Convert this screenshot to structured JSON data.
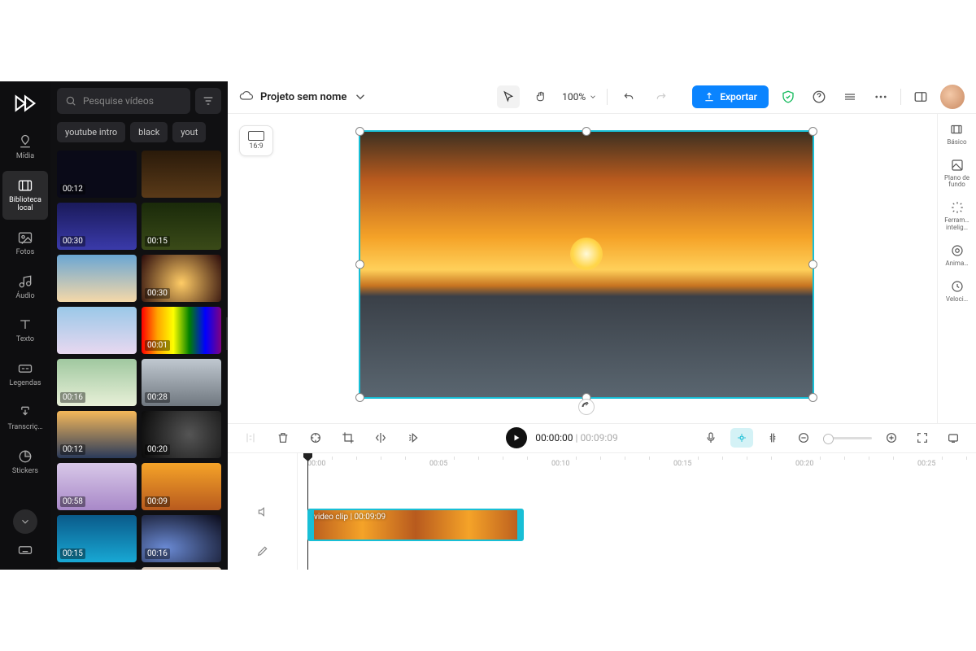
{
  "rail": {
    "items": [
      {
        "label": "Mídia"
      },
      {
        "label": "Biblioteca local"
      },
      {
        "label": "Fotos"
      },
      {
        "label": "Áudio"
      },
      {
        "label": "Texto"
      },
      {
        "label": "Legendas"
      },
      {
        "label": "Transcriç…"
      },
      {
        "label": "Stickers"
      }
    ]
  },
  "library": {
    "search_placeholder": "Pesquise vídeos",
    "chips": [
      "youtube intro",
      "black",
      "yout"
    ],
    "thumbs": [
      {
        "dur": "00:12",
        "bg": "#0a0a18"
      },
      {
        "dur": "",
        "bg": "linear-gradient(#2a1a0a,#5a3a18)"
      },
      {
        "dur": "00:30",
        "bg": "linear-gradient(#1a1a5a,#3a3aaa)"
      },
      {
        "dur": "00:15",
        "bg": "linear-gradient(#1a2a0a,#3a4a18)"
      },
      {
        "dur": "",
        "bg": "linear-gradient(#6aa6d4,#f5d8a8)"
      },
      {
        "dur": "00:30",
        "bg": "radial-gradient(circle at 50% 60%,#ffcc66,#2a0a0a)"
      },
      {
        "dur": "",
        "bg": "linear-gradient(#9ac8e8,#e8d8f0)"
      },
      {
        "dur": "00:01",
        "bg": "linear-gradient(to right,red,orange,yellow,green,blue,purple)"
      },
      {
        "dur": "00:16",
        "bg": "linear-gradient(#a0c8a0,#e8f0d8)"
      },
      {
        "dur": "00:28",
        "bg": "linear-gradient(#c0c8d0,#707880)"
      },
      {
        "dur": "00:12",
        "bg": "linear-gradient(#f5b85a,#2a3a5a)"
      },
      {
        "dur": "00:20",
        "bg": "radial-gradient(circle at 60% 50%,#555,#0a0a0a)"
      },
      {
        "dur": "00:58",
        "bg": "linear-gradient(#d8c8e8,#a888c8)"
      },
      {
        "dur": "00:09",
        "bg": "linear-gradient(#f5a328,#b85a1e)"
      },
      {
        "dur": "00:15",
        "bg": "linear-gradient(#0a5a8a,#18a8d4)"
      },
      {
        "dur": "00:16",
        "bg": "radial-gradient(ellipse at 30% 70%,#6a8ad4,#0a0a18)"
      },
      {
        "dur": "",
        "bg": "#1a1a1a"
      },
      {
        "dur": "",
        "bg": "linear-gradient(#d8c8b8,#f5e8d8)"
      }
    ]
  },
  "topbar": {
    "project_name": "Projeto sem nome",
    "zoom": "100%",
    "export_label": "Exportar"
  },
  "canvas": {
    "ratio": "16:9"
  },
  "inspector": {
    "items": [
      "Básico",
      "Plano de fundo",
      "Ferram… intelig…",
      "Anima…",
      "Veloci…"
    ]
  },
  "timeline": {
    "current": "00:00:00",
    "total": "00:09:09",
    "clip_label": "video clip",
    "clip_dur": "00:09:09",
    "ticks": [
      "00:00",
      "00:05",
      "00:10",
      "00:15",
      "00:20",
      "00:25"
    ]
  }
}
